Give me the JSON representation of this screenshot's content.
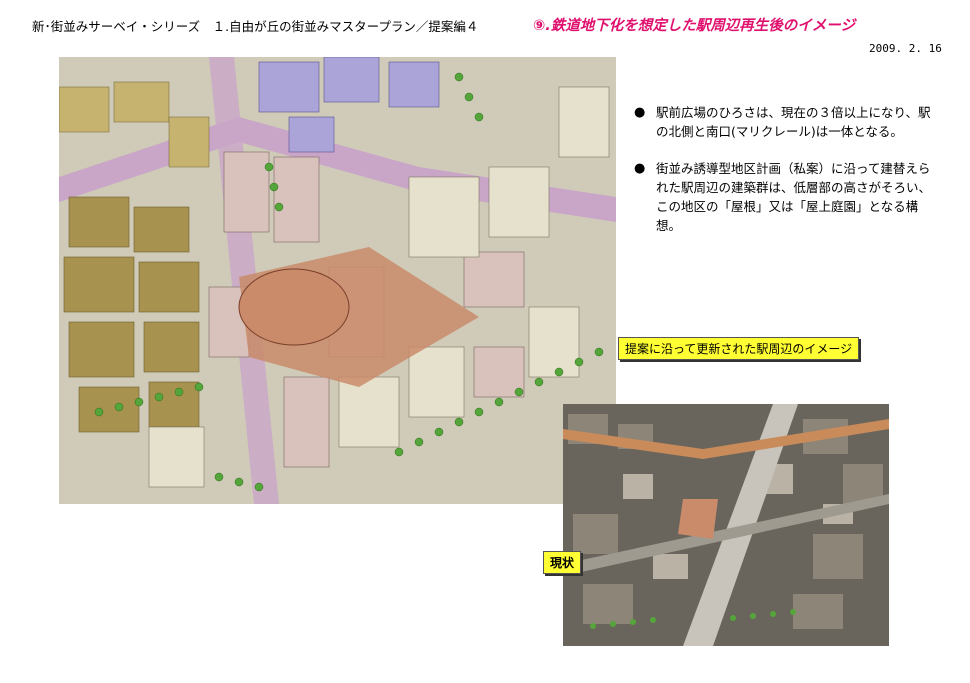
{
  "header": {
    "series": "新･街並みサーベイ・シリーズ　１.自由が丘の街並みマスタープラン／提案編４",
    "title": "⑨.鉄道地下化を想定した駅周辺再生後のイメージ",
    "date": "2009. 2. 16"
  },
  "bullets": [
    "駅前広場のひろさは、現在の３倍以上になり、駅の北側と南口(マリクレール)は一体となる。",
    "街並み誘導型地区計画（私案）に沿って建替えられた駅周辺の建築群は、低層部の高さがそろい、この地区の「屋根」又は「屋上庭園」となる構想。"
  ],
  "labels": {
    "proposal": "提案に沿って更新された駅周辺のイメージ",
    "current": "現状"
  },
  "colors": {
    "title": "#e0106e",
    "label_bg": "#ffff33",
    "plaza": "#c98b6a",
    "road": "#c9a5c8",
    "tree": "#55a63a"
  }
}
